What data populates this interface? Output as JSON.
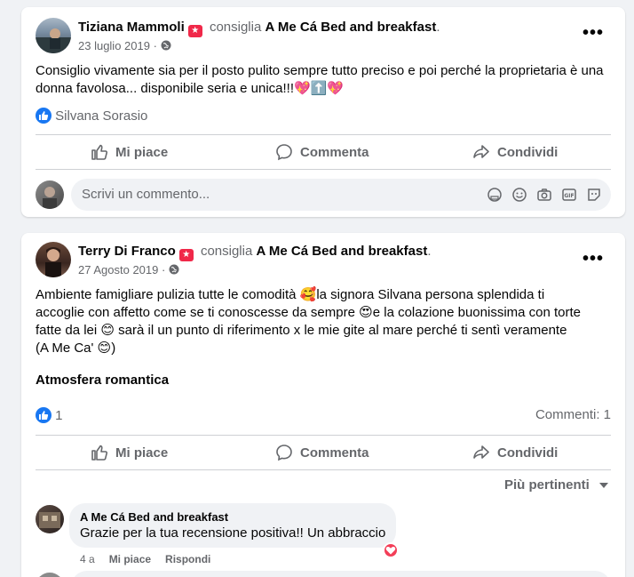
{
  "posts": [
    {
      "author": "Tiziana Mammoli",
      "verb": "consiglia",
      "page": "A Me Cá Bed and breakfast",
      "date": "23 luglio 2019",
      "dot": "·",
      "body": "Consiglio vivamente sia per il posto pulito sempre tutto preciso e poi perché la proprietaria è una donna favolosa... disponibile seria e unica!!!💖⬆️💖",
      "reactors": "Silvana Sorasio",
      "actions": {
        "like": "Mi piace",
        "comment": "Commenta",
        "share": "Condividi"
      },
      "comment_placeholder": "Scrivi un commento..."
    },
    {
      "author": "Terry Di Franco",
      "verb": "consiglia",
      "page": "A Me Cá Bed and breakfast",
      "date": "27 Agosto 2019",
      "dot": "·",
      "body_lines": [
        "Ambiente famigliare pulizia tutte le comodità 🥰la signora Silvana persona splendida ti",
        "accoglie con affetto come se ti conoscesse da sempre 😍e la colazione buonissima con torte",
        "fatte da lei 😊 sarà il un punto di riferimento x le mie gite al mare perché ti sentì veramente",
        "(A Me Ca' 😊)"
      ],
      "highlight": "Atmosfera romantica",
      "reaction_count": "1",
      "comments_count": "Commenti: 1",
      "actions": {
        "like": "Mi piace",
        "comment": "Commenta",
        "share": "Condividi"
      },
      "sort_label": "Più pertinenti",
      "reply": {
        "author": "A Me Cá Bed and breakfast",
        "text": "Grazie per la tua recensione positiva!! Un abbraccio",
        "time": "4 a",
        "like": "Mi piace",
        "reply": "Rispondi"
      }
    }
  ],
  "icons": {
    "more": "more-options-icon",
    "globe": "globe-icon",
    "like": "thumbs-up-icon",
    "comment": "comment-bubble-icon",
    "share": "share-arrow-icon",
    "recommend": "recommend-badge-icon"
  },
  "colors": {
    "accent": "#1877f2",
    "heart": "#f33e58",
    "recommend": "#f02849",
    "muted": "#65676b"
  }
}
